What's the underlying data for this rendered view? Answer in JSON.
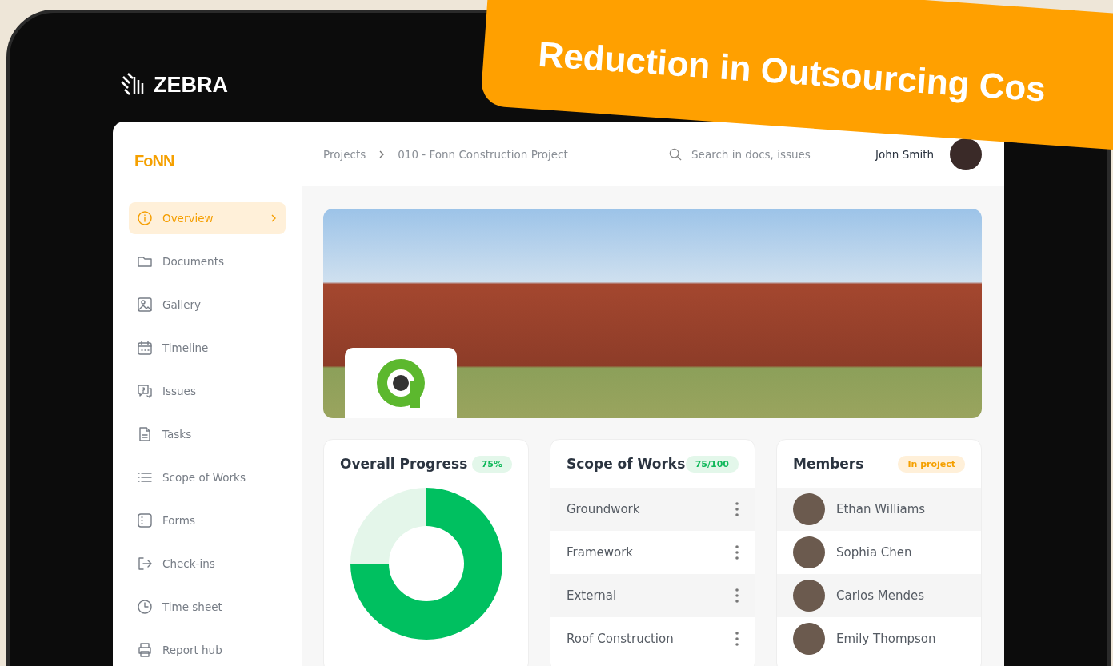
{
  "banner": {
    "title": "Reduction in Outsourcing Cos"
  },
  "device": {
    "brand": "ZEBRA"
  },
  "app": {
    "logo": "FoNN"
  },
  "breadcrumb": [
    "Projects",
    "010 - Fonn Construction Project"
  ],
  "search": {
    "placeholder": "Search in docs, issues"
  },
  "user": {
    "name": "John Smith"
  },
  "sidebar": {
    "items": [
      {
        "label": "Overview",
        "selected": true
      },
      {
        "label": "Documents",
        "selected": false
      },
      {
        "label": "Gallery",
        "selected": false
      },
      {
        "label": "Timeline",
        "selected": false
      },
      {
        "label": "Issues",
        "selected": false
      },
      {
        "label": "Tasks",
        "selected": false
      },
      {
        "label": "Scope of Works",
        "selected": false
      },
      {
        "label": "Forms",
        "selected": false
      },
      {
        "label": "Check-ins",
        "selected": false
      },
      {
        "label": "Time sheet",
        "selected": false
      },
      {
        "label": "Report hub",
        "selected": false
      }
    ]
  },
  "progress": {
    "title": "Overall Progress",
    "badge": "75%",
    "chart_data": {
      "type": "donut",
      "values": [
        75,
        25
      ]
    }
  },
  "scope": {
    "title": "Scope of  Works",
    "badge": "75/100",
    "rows": [
      "Groundwork",
      "Framework",
      "External",
      "Roof Construction"
    ]
  },
  "members": {
    "title": "Members",
    "badge": "In project",
    "rows": [
      "Ethan Williams",
      "Sophia Chen",
      "Carlos Mendes",
      "Emily Thompson"
    ]
  }
}
